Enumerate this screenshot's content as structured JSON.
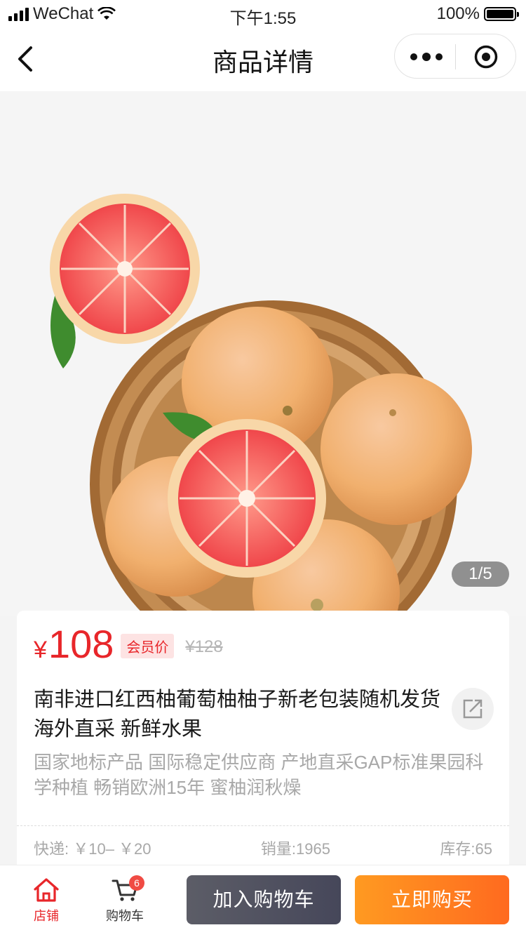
{
  "status_bar": {
    "carrier": "WeChat",
    "time": "下午1:55",
    "battery": "100%"
  },
  "nav": {
    "title": "商品详情",
    "back_icon": "chevron-left-icon",
    "more_icon": "more-dots-icon",
    "close_icon": "miniprogram-close-icon"
  },
  "gallery": {
    "current": "1",
    "total": "5",
    "separator": "/"
  },
  "product": {
    "currency": "¥",
    "price": "108",
    "member_label": "会员价",
    "original_price": "¥128",
    "title": "南非进口红西柚葡萄柚柚子新老包装随机发货 海外直采 新鲜水果",
    "description": "国家地标产品  国际稳定供应商  产地直采GAP标准果园科学种植 畅销欧洲15年 蜜柚润秋燥",
    "shipping": "快递: ￥10– ￥20",
    "sales": "销量:1965",
    "stock": "库存:65",
    "share_icon": "share-icon"
  },
  "bottom_bar": {
    "shop_label": "店铺",
    "cart_label": "购物车",
    "cart_count": "6",
    "add_to_cart": "加入购物车",
    "buy_now": "立即购买"
  },
  "colors": {
    "accent_red": "#e8262a",
    "buy_orange": "#ff7a1f",
    "cart_dark": "#4f505e"
  }
}
